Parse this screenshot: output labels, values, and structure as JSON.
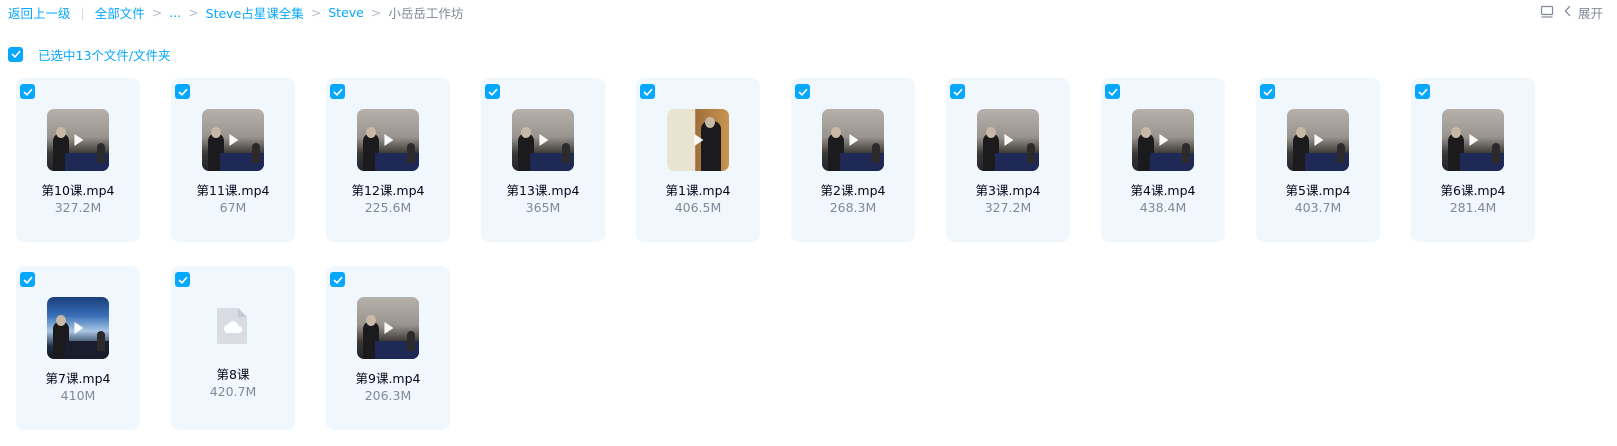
{
  "breadcrumb": {
    "back": "返回上一级",
    "all_files": "全部文件",
    "ellipsis": "...",
    "course": "Steve占星课全集",
    "steve": "Steve",
    "current": "小岳岳工作坊",
    "sep": ">"
  },
  "toolbar": {
    "expand_label": "展开",
    "layout_icon": "list-view-icon",
    "collapse_icon": "chevron-left-icon"
  },
  "selection": {
    "text": "已选中13个文件/文件夹"
  },
  "colors": {
    "accent": "#06a7ff",
    "card_bg": "#f1f8fd",
    "muted": "#818999"
  },
  "files": [
    {
      "name": "第10课.mp4",
      "size": "327.2M",
      "thumb": "video"
    },
    {
      "name": "第11课.mp4",
      "size": "67M",
      "thumb": "video"
    },
    {
      "name": "第12课.mp4",
      "size": "225.6M",
      "thumb": "video"
    },
    {
      "name": "第13课.mp4",
      "size": "365M",
      "thumb": "video"
    },
    {
      "name": "第1课.mp4",
      "size": "406.5M",
      "thumb": "banner"
    },
    {
      "name": "第2课.mp4",
      "size": "268.3M",
      "thumb": "video"
    },
    {
      "name": "第3课.mp4",
      "size": "327.2M",
      "thumb": "video"
    },
    {
      "name": "第4课.mp4",
      "size": "438.4M",
      "thumb": "video"
    },
    {
      "name": "第5课.mp4",
      "size": "403.7M",
      "thumb": "video"
    },
    {
      "name": "第6课.mp4",
      "size": "281.4M",
      "thumb": "video"
    },
    {
      "name": "第7课.mp4",
      "size": "410M",
      "thumb": "screen"
    },
    {
      "name": "第8课",
      "size": "420.7M",
      "thumb": "cloud-file-icon"
    },
    {
      "name": "第9课.mp4",
      "size": "206.3M",
      "thumb": "video"
    }
  ]
}
